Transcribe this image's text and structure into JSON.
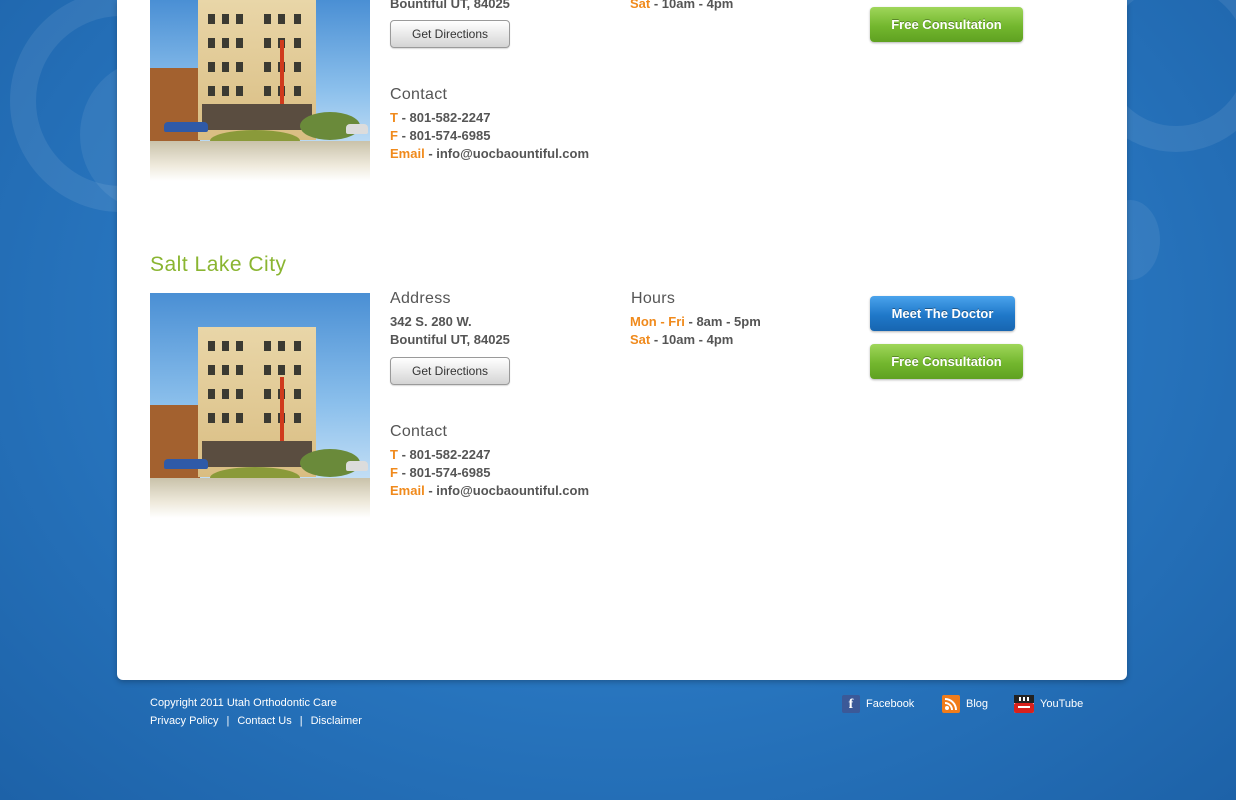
{
  "locations_top": {
    "address_line2": "Bountiful UT, 84025",
    "directions_label": "Get Directions",
    "hours_sat_day": "Sat",
    "hours_sat_time": "- 10am - 4pm",
    "consult_label": "Free Consultation",
    "contact_heading": "Contact",
    "tel_key": "T",
    "tel_val": "- 801-582-2247",
    "fax_key": "F",
    "fax_val": "- 801-574-6985",
    "email_key": "Email",
    "email_val": "- info@uocbaountiful.com"
  },
  "location_slc": {
    "city": "Salt Lake City",
    "address_heading": "Address",
    "address_line1": "342 S. 280 W.",
    "address_line2": "Bountiful UT, 84025",
    "directions_label": "Get Directions",
    "hours_heading": "Hours",
    "hours_weekday_day": "Mon - Fri",
    "hours_weekday_time": "- 8am - 5pm",
    "hours_sat_day": "Sat",
    "hours_sat_time": "- 10am - 4pm",
    "doctor_label": "Meet The Doctor",
    "consult_label": "Free Consultation",
    "contact_heading": "Contact",
    "tel_key": "T",
    "tel_val": "- 801-582-2247",
    "fax_key": "F",
    "fax_val": "- 801-574-6985",
    "email_key": "Email",
    "email_val": "- info@uocbaountiful.com"
  },
  "footer": {
    "copyright": "Copyright 2011 Utah Orthodontic Care",
    "links": [
      "Privacy Policy",
      "Contact Us",
      "Disclaimer"
    ],
    "separator": "|",
    "social": [
      {
        "label": "Facebook",
        "icon": "facebook-icon"
      },
      {
        "label": "Blog",
        "icon": "rss-icon"
      },
      {
        "label": "YouTube",
        "icon": "youtube-icon"
      }
    ]
  },
  "colors": {
    "accent_orange": "#f08a1c",
    "city_green": "#8ab531",
    "background_blue": "#2a79c3"
  }
}
